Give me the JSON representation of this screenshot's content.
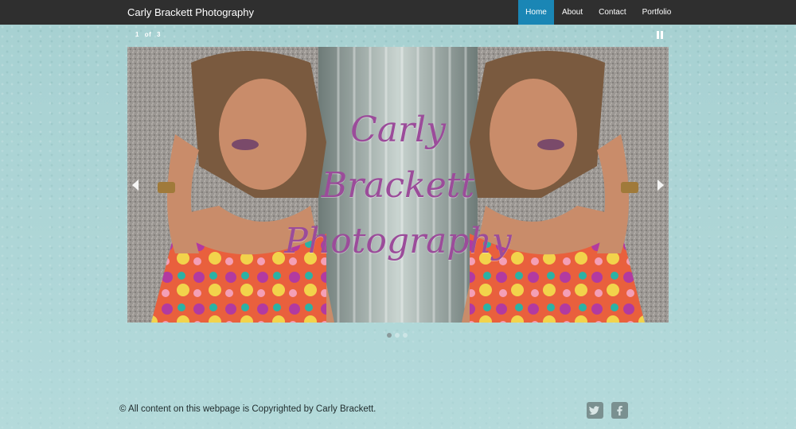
{
  "nav": {
    "brand": "Carly Brackett Photography",
    "links": [
      {
        "label": "Home",
        "active": true
      },
      {
        "label": "About"
      },
      {
        "label": "Contact"
      },
      {
        "label": "Portfolio"
      }
    ]
  },
  "slideshow": {
    "current": "1",
    "of": "of",
    "total": "3",
    "overlay_lines": [
      "Carly",
      "Brackett",
      "Photography"
    ],
    "dots": 3,
    "active_dot": 0
  },
  "footer": {
    "copyright": "© All content on this webpage is Copyrighted by Carly Brackett.",
    "social": [
      "twitter-icon",
      "facebook-icon"
    ]
  },
  "colors": {
    "nav_bg": "#2f2f2f",
    "active_tab": "#1a86b5",
    "overlay_text": "#9b4c9a",
    "background": "#a7d1d2"
  }
}
